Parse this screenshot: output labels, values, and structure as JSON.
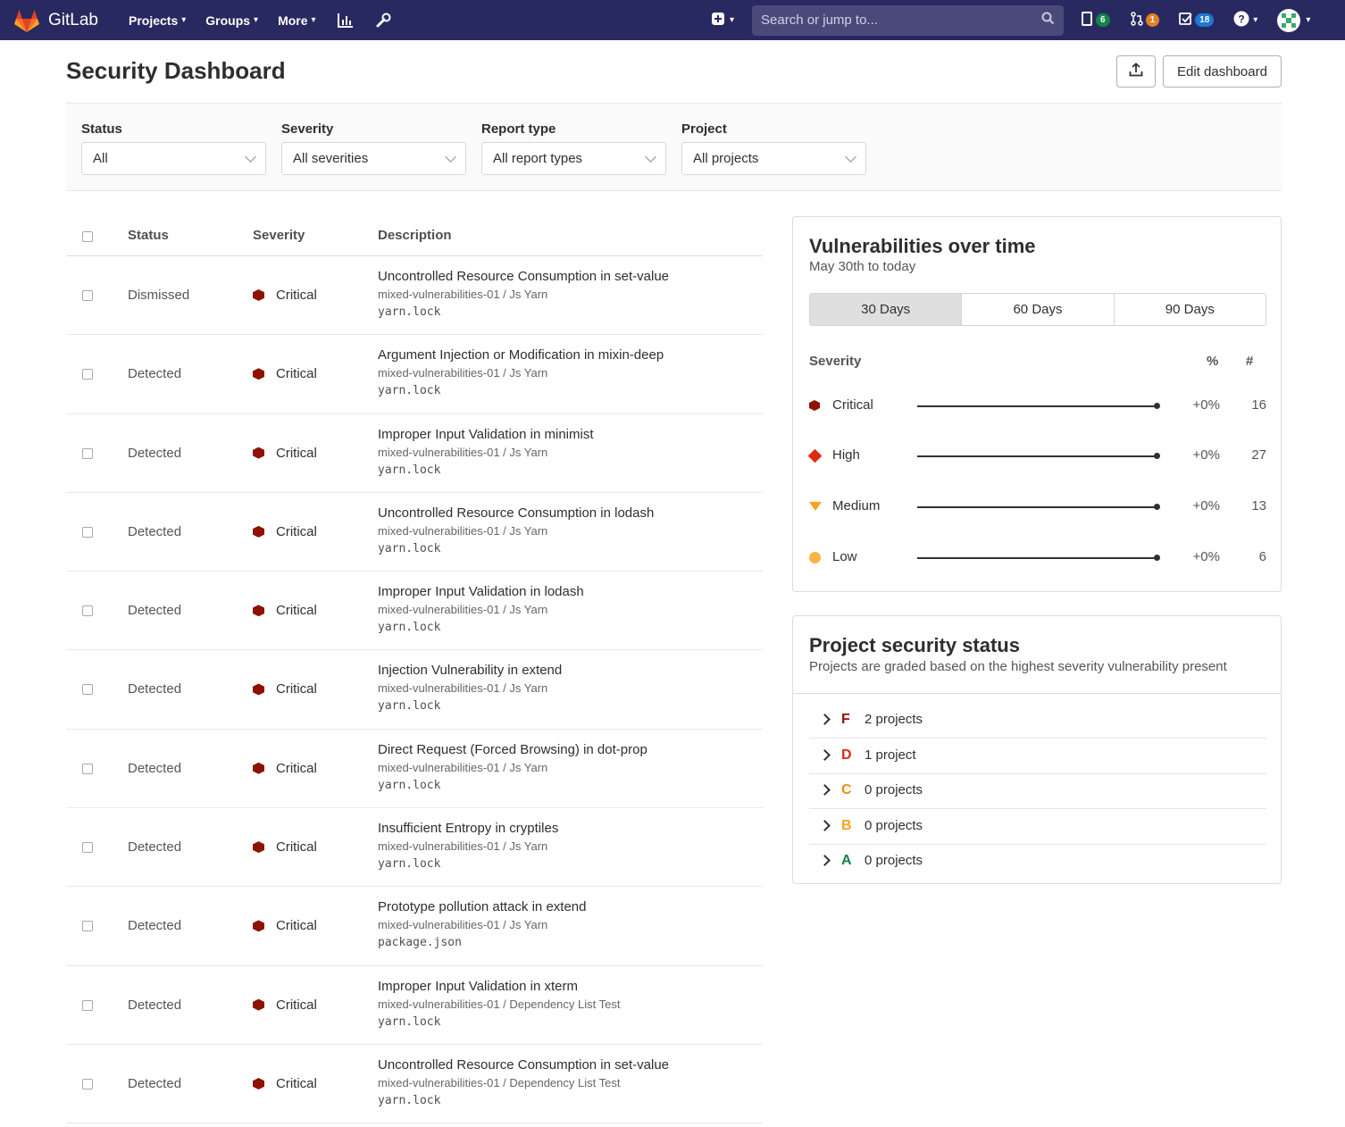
{
  "navbar": {
    "brand": "GitLab",
    "menu": [
      {
        "label": "Projects"
      },
      {
        "label": "Groups"
      },
      {
        "label": "More"
      }
    ],
    "search_placeholder": "Search or jump to...",
    "issues_count": "6",
    "merge_requests_count": "1",
    "todos_count": "18",
    "colors": {
      "bg": "#292961",
      "issues_badge": "#108548",
      "mr_badge": "#e67e22",
      "todos_badge": "#1f78d1"
    }
  },
  "header": {
    "title": "Security Dashboard",
    "edit_button": "Edit dashboard"
  },
  "filters": [
    {
      "label": "Status",
      "value": "All"
    },
    {
      "label": "Severity",
      "value": "All severities"
    },
    {
      "label": "Report type",
      "value": "All report types"
    },
    {
      "label": "Project",
      "value": "All projects"
    }
  ],
  "table": {
    "headers": {
      "status": "Status",
      "severity": "Severity",
      "description": "Description"
    },
    "rows": [
      {
        "status": "Dismissed",
        "severity": "Critical",
        "title": "Uncontrolled Resource Consumption in set-value",
        "project": "mixed-vulnerabilities-01 / Js Yarn",
        "file": "yarn.lock"
      },
      {
        "status": "Detected",
        "severity": "Critical",
        "title": "Argument Injection or Modification in mixin-deep",
        "project": "mixed-vulnerabilities-01 / Js Yarn",
        "file": "yarn.lock"
      },
      {
        "status": "Detected",
        "severity": "Critical",
        "title": "Improper Input Validation in minimist",
        "project": "mixed-vulnerabilities-01 / Js Yarn",
        "file": "yarn.lock"
      },
      {
        "status": "Detected",
        "severity": "Critical",
        "title": "Uncontrolled Resource Consumption in lodash",
        "project": "mixed-vulnerabilities-01 / Js Yarn",
        "file": "yarn.lock"
      },
      {
        "status": "Detected",
        "severity": "Critical",
        "title": "Improper Input Validation in lodash",
        "project": "mixed-vulnerabilities-01 / Js Yarn",
        "file": "yarn.lock"
      },
      {
        "status": "Detected",
        "severity": "Critical",
        "title": "Injection Vulnerability in extend",
        "project": "mixed-vulnerabilities-01 / Js Yarn",
        "file": "yarn.lock"
      },
      {
        "status": "Detected",
        "severity": "Critical",
        "title": "Direct Request (Forced Browsing) in dot-prop",
        "project": "mixed-vulnerabilities-01 / Js Yarn",
        "file": "yarn.lock"
      },
      {
        "status": "Detected",
        "severity": "Critical",
        "title": "Insufficient Entropy in cryptiles",
        "project": "mixed-vulnerabilities-01 / Js Yarn",
        "file": "yarn.lock"
      },
      {
        "status": "Detected",
        "severity": "Critical",
        "title": "Prototype pollution attack in extend",
        "project": "mixed-vulnerabilities-01 / Js Yarn",
        "file": "package.json"
      },
      {
        "status": "Detected",
        "severity": "Critical",
        "title": "Improper Input Validation in xterm",
        "project": "mixed-vulnerabilities-01 / Dependency List Test",
        "file": "yarn.lock"
      },
      {
        "status": "Detected",
        "severity": "Critical",
        "title": "Uncontrolled Resource Consumption in set-value",
        "project": "mixed-vulnerabilities-01 / Dependency List Test",
        "file": "yarn.lock"
      }
    ]
  },
  "vulnerabilities_over_time": {
    "title": "Vulnerabilities over time",
    "subtitle": "May 30th to today",
    "ranges": [
      "30 Days",
      "60 Days",
      "90 Days"
    ],
    "active_range": "30 Days",
    "headers": {
      "severity": "Severity",
      "percent": "%",
      "count": "#"
    },
    "rows": [
      {
        "name": "Critical",
        "icon": "critical-hexagon-icon",
        "percent": "+0%",
        "count": "16"
      },
      {
        "name": "High",
        "icon": "high-diamond-icon",
        "percent": "+0%",
        "count": "27"
      },
      {
        "name": "Medium",
        "icon": "medium-triangle-icon",
        "percent": "+0%",
        "count": "13"
      },
      {
        "name": "Low",
        "icon": "low-circle-icon",
        "percent": "+0%",
        "count": "6"
      }
    ]
  },
  "project_security_status": {
    "title": "Project security status",
    "subtitle": "Projects are graded based on the highest severity vulnerability present",
    "grades": [
      {
        "letter": "F",
        "count": "2 projects",
        "color": "#8d1300"
      },
      {
        "letter": "D",
        "count": "1 project",
        "color": "#dd2b0e"
      },
      {
        "letter": "C",
        "count": "0 projects",
        "color": "#ef8e0f"
      },
      {
        "letter": "B",
        "count": "0 projects",
        "color": "#f6a31f"
      },
      {
        "letter": "A",
        "count": "0 projects",
        "color": "#108548"
      }
    ]
  }
}
